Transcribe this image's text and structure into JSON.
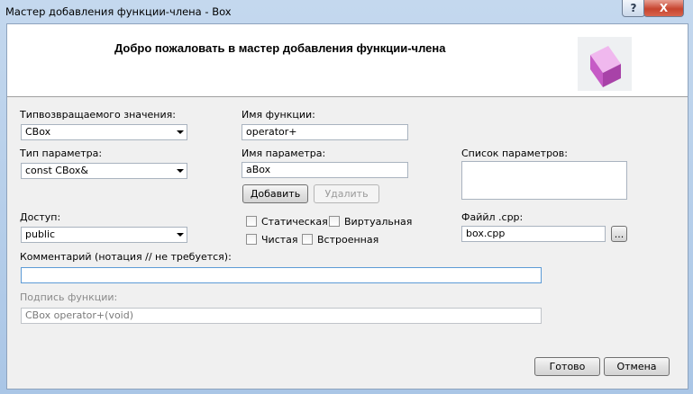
{
  "window": {
    "title": "Мастер добавления функции-члена - Box",
    "help": "?",
    "close": "X"
  },
  "header": {
    "welcome": "Добро пожаловать в мастер добавления функции-члена"
  },
  "return_type": {
    "label": "Типвозвращаемого значения:",
    "value": "CBox"
  },
  "function_name": {
    "label": "Имя функции:",
    "value": "operator+"
  },
  "param_type": {
    "label": "Тип параметра:",
    "value": "const CBox&"
  },
  "param_name": {
    "label": "Имя параметра:",
    "value": "aBox"
  },
  "param_list": {
    "label": "Список параметров:"
  },
  "buttons": {
    "add": "Добавить",
    "remove": "Удалить",
    "browse": "...",
    "ok": "Готово",
    "cancel": "Отмена"
  },
  "access": {
    "label": "Доступ:",
    "value": "public"
  },
  "modifiers": {
    "static": "Статическая",
    "virtual": "Виртуальная",
    "pure": "Чистая",
    "inline": "Встроенная"
  },
  "cpp_file": {
    "label": "Файйл .cpp:",
    "value": "box.cpp"
  },
  "comment": {
    "label": "Комментарий (нотация // не требуется):",
    "value": ""
  },
  "signature": {
    "label": "Подпись функции:",
    "value": "CBox operator+(void)"
  }
}
